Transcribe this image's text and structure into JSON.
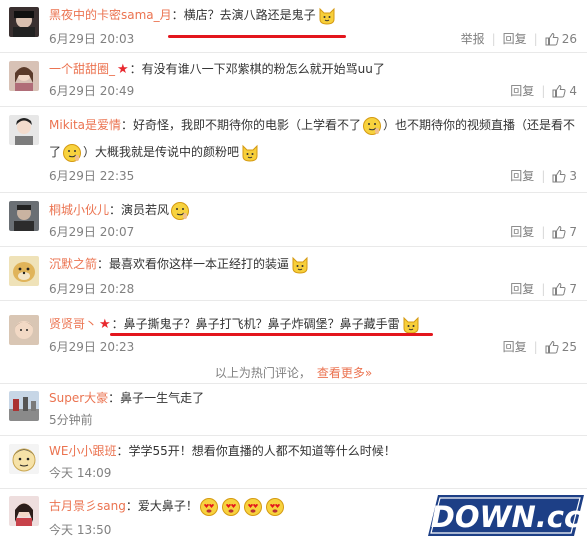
{
  "comments": [
    {
      "user": "黑夜中的卡密sama_月",
      "text": "：横店？去演八路还是鬼子",
      "time": "6月29日 20:03",
      "report": "举报",
      "reply": "回复",
      "likes": "26"
    },
    {
      "user": "一个甜甜圈_",
      "text": "：有没有谁八一下邓紫棋的粉怎么就开始骂uu了",
      "time": "6月29日 20:49",
      "reply": "回复",
      "likes": "4"
    },
    {
      "user": "Mikita是爱情",
      "text_a": "：好奇怪，我即不期待你的电影（上学看不了",
      "text_b": "）也不期待你的视频直播（还是看不",
      "text_c": "了",
      "text_d": "）大概我就是传说中的颜粉吧",
      "time": "6月29日 22:35",
      "reply": "回复",
      "likes": "3"
    },
    {
      "user": "桐城小伙儿",
      "text": "：演员若风",
      "time": "6月29日 20:07",
      "reply": "回复",
      "likes": "7"
    },
    {
      "user": "沉默之箭",
      "text": "：最喜欢看你这样一本正经打的装逼",
      "time": "6月29日 20:28",
      "reply": "回复",
      "likes": "7"
    },
    {
      "user": "贤贤哥丶",
      "text": "：鼻子撕鬼子？鼻子打飞机？鼻子炸碉堡？鼻子藏手雷",
      "time": "6月29日 20:23",
      "reply": "回复",
      "likes": "25"
    },
    {
      "user": "Super大豪",
      "text": "：鼻子一生气走了",
      "time": "5分钟前"
    },
    {
      "user": "WE小小跟班",
      "text": "：学学55开！想看你直播的人都不知道等什么时候！",
      "time": "今天 14:09"
    },
    {
      "user": "古月景彡sang",
      "text": "：爱大鼻子！",
      "time": "今天 13:50"
    }
  ],
  "hot_bar": {
    "text": "以上为热门评论，",
    "more": "查看更多»"
  },
  "colors": {
    "username": "#eb7350",
    "meta": "#808080",
    "underline": "#e3161d"
  },
  "watermark": {
    "text": "DOWN.cc"
  }
}
